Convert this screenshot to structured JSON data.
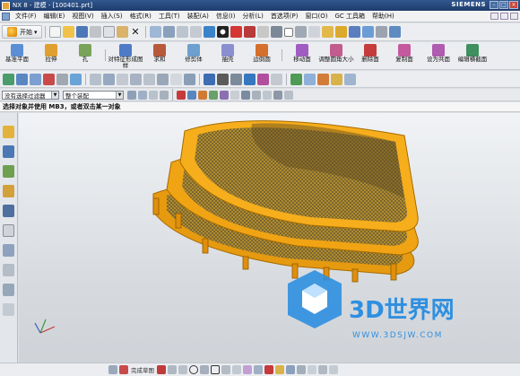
{
  "window": {
    "title": "NX 8 - 建模 - [100401.prt]",
    "brand": "SIEMENS",
    "buttons": [
      "–",
      "□",
      "×"
    ]
  },
  "menu": {
    "items": [
      "文件(F)",
      "编辑(E)",
      "视图(V)",
      "插入(S)",
      "格式(R)",
      "工具(T)",
      "装配(A)",
      "信息(I)",
      "分析(L)",
      "首选项(P)",
      "窗口(O)",
      "GC 工具箱",
      "帮助(H)"
    ]
  },
  "toolbar1": {
    "start_label": "开始",
    "dropdown_arrow": "▾"
  },
  "toolbar2": {
    "tools": [
      {
        "label": "基准平面",
        "icon": "datum-plane-icon",
        "color": "#5a8fd6"
      },
      {
        "label": "拉伸",
        "icon": "extrude-icon",
        "color": "#e0a030"
      },
      {
        "label": "孔",
        "icon": "hole-icon",
        "color": "#7aa35a"
      },
      {
        "label": "对特征形成图样",
        "icon": "pattern-feature-icon",
        "color": "#4f7bc6"
      },
      {
        "label": "求和",
        "icon": "unite-icon",
        "color": "#b85a3a"
      },
      {
        "label": "修剪体",
        "icon": "trim-body-icon",
        "color": "#6da0cf"
      },
      {
        "label": "抽壳",
        "icon": "shell-icon",
        "color": "#8a8fd0"
      },
      {
        "label": "边倒圆",
        "icon": "edge-blend-icon",
        "color": "#d46f2c"
      },
      {
        "label": "移动面",
        "icon": "move-face-icon",
        "color": "#a15cc2"
      },
      {
        "label": "调整圆角大小",
        "icon": "resize-blend-icon",
        "color": "#c25c8e"
      },
      {
        "label": "删除面",
        "icon": "delete-face-icon",
        "color": "#c43c3c"
      },
      {
        "label": "复制面",
        "icon": "copy-face-icon",
        "color": "#c45a9e"
      },
      {
        "label": "设为共面",
        "icon": "make-coplanar-icon",
        "color": "#b05bb0"
      },
      {
        "label": "编辑横截面",
        "icon": "edit-cross-section-icon",
        "color": "#3f8f5f"
      }
    ]
  },
  "selection_bar": {
    "filter_value": "没有选择过滤器",
    "scope_value": "整个装配"
  },
  "status": {
    "prompt": "选择对象并使用 MB3，或者双击某一对象"
  },
  "bottom": {
    "sketch_label": "完成草图"
  },
  "watermark": {
    "title": "3D世界网",
    "url": "WWW.3DSJW.COM",
    "color": "#2f8fe0"
  },
  "model": {
    "frame_color": "#f0a010",
    "mesh_color": "#7a6a3a"
  }
}
